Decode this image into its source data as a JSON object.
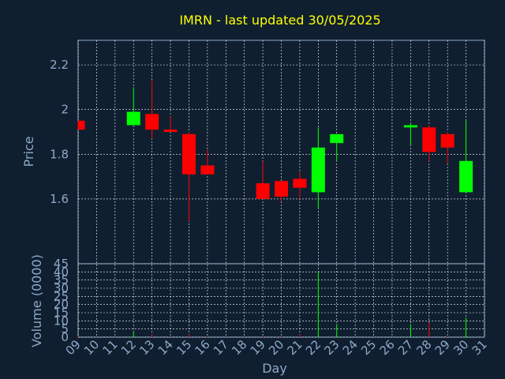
{
  "chart_data": {
    "type": "candlestick",
    "title": "IMRN - last updated 30/05/2025",
    "xlabel": "Day",
    "colors": {
      "background": "#0f1f30",
      "title": "#ffff00",
      "axis_text": "#8fa8c8",
      "grid": "#ffffff",
      "up": "#00ff00",
      "down": "#ff0000"
    },
    "price_panel": {
      "ylabel": "Price",
      "ylim": [
        1.31,
        2.31
      ],
      "yticks": [
        {
          "value": 1.6,
          "label": "1.6"
        },
        {
          "value": 1.8,
          "label": "1.8"
        },
        {
          "value": 2.0,
          "label": "2"
        },
        {
          "value": 2.2,
          "label": "2.2"
        }
      ]
    },
    "volume_panel": {
      "ylabel": "Volume (0000)",
      "ylim": [
        0,
        45
      ],
      "yticks": [
        {
          "value": 0,
          "label": "0"
        },
        {
          "value": 5,
          "label": "5"
        },
        {
          "value": 10,
          "label": "10"
        },
        {
          "value": 15,
          "label": "15"
        },
        {
          "value": 20,
          "label": "20"
        },
        {
          "value": 25,
          "label": "25"
        },
        {
          "value": 30,
          "label": "30"
        },
        {
          "value": 35,
          "label": "35"
        },
        {
          "value": 40,
          "label": "40"
        },
        {
          "value": 45,
          "label": "45"
        }
      ]
    },
    "x_ticks": [
      "09",
      "10",
      "11",
      "12",
      "13",
      "14",
      "15",
      "16",
      "17",
      "18",
      "19",
      "20",
      "21",
      "22",
      "23",
      "24",
      "25",
      "26",
      "27",
      "28",
      "29",
      "30",
      "31"
    ],
    "candles": [
      {
        "day": "09",
        "open": 1.95,
        "high": 1.95,
        "low": 1.91,
        "close": 1.91,
        "volume": 0.5
      },
      {
        "day": "12",
        "open": 1.93,
        "high": 2.1,
        "low": 1.93,
        "close": 1.99,
        "volume": 3
      },
      {
        "day": "13",
        "open": 1.98,
        "high": 2.13,
        "low": 1.87,
        "close": 1.91,
        "volume": 2
      },
      {
        "day": "14",
        "open": 1.91,
        "high": 1.97,
        "low": 1.9,
        "close": 1.9,
        "volume": 0.5
      },
      {
        "day": "15",
        "open": 1.89,
        "high": 1.9,
        "low": 1.5,
        "close": 1.71,
        "volume": 2
      },
      {
        "day": "16",
        "open": 1.75,
        "high": 1.82,
        "low": 1.71,
        "close": 1.71,
        "volume": 0.5
      },
      {
        "day": "19",
        "open": 1.67,
        "high": 1.77,
        "low": 1.6,
        "close": 1.6,
        "volume": 0.5
      },
      {
        "day": "20",
        "open": 1.68,
        "high": 1.68,
        "low": 1.59,
        "close": 1.61,
        "volume": 0.5
      },
      {
        "day": "21",
        "open": 1.69,
        "high": 1.72,
        "low": 1.6,
        "close": 1.65,
        "volume": 2
      },
      {
        "day": "22",
        "open": 1.63,
        "high": 1.92,
        "low": 1.56,
        "close": 1.83,
        "volume": 40
      },
      {
        "day": "23",
        "open": 1.85,
        "high": 1.89,
        "low": 1.77,
        "close": 1.89,
        "volume": 8
      },
      {
        "day": "27",
        "open": 1.92,
        "high": 1.94,
        "low": 1.84,
        "close": 1.93,
        "volume": 8
      },
      {
        "day": "28",
        "open": 1.92,
        "high": 1.93,
        "low": 1.77,
        "close": 1.81,
        "volume": 9
      },
      {
        "day": "29",
        "open": 1.89,
        "high": 1.9,
        "low": 1.76,
        "close": 1.83,
        "volume": 0.5
      },
      {
        "day": "30",
        "open": 1.63,
        "high": 1.95,
        "low": 1.63,
        "close": 1.77,
        "volume": 12
      }
    ]
  }
}
